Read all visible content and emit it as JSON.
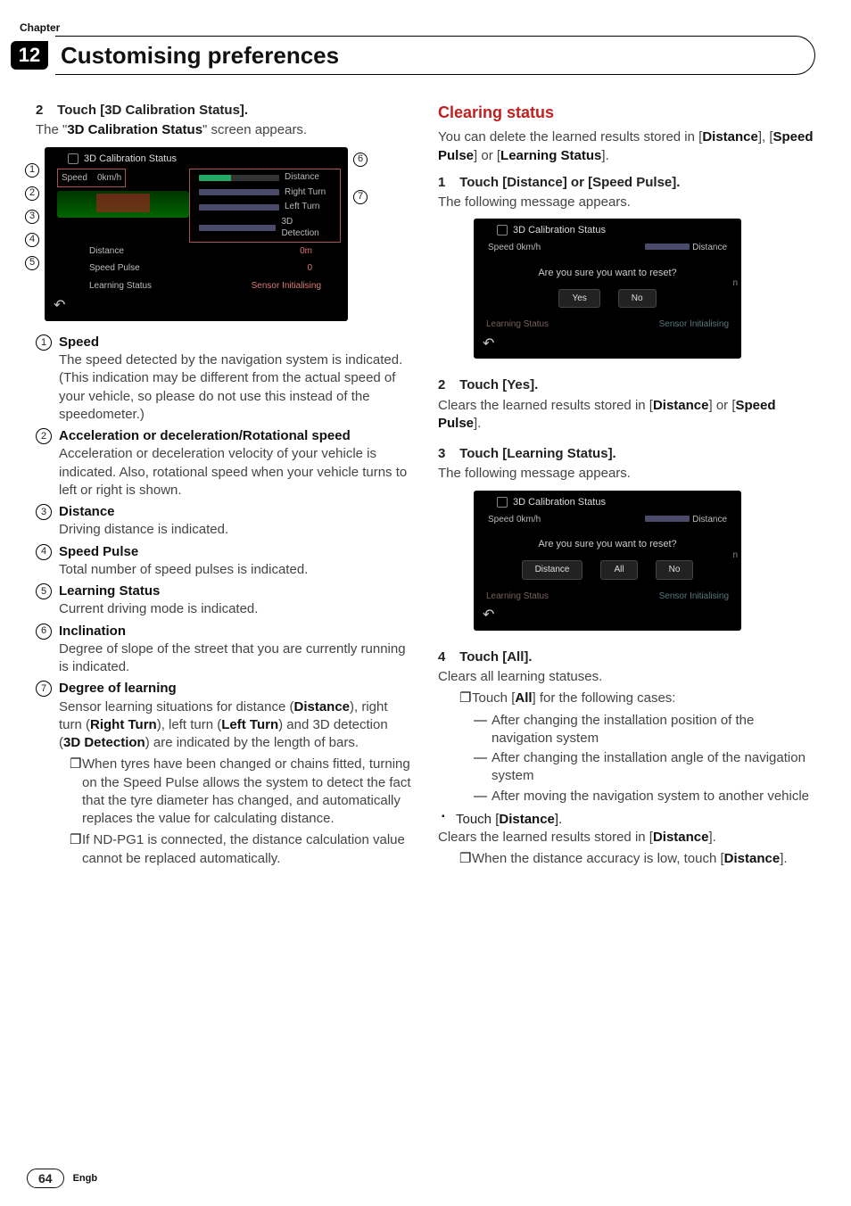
{
  "chapter": {
    "label": "Chapter",
    "number": "12",
    "title": "Customising preferences"
  },
  "left": {
    "step2": {
      "num": "2",
      "title": "Touch [3D Calibration Status].",
      "desc_a": "The \"",
      "desc_b": "3D Calibration Status",
      "desc_c": "\" screen appears."
    },
    "fig1": {
      "title": "3D Calibration Status",
      "speed_lbl": "Speed",
      "speed_val": "0km/h",
      "bars": [
        {
          "label": "Distance"
        },
        {
          "label": "Right Turn"
        },
        {
          "label": "Left Turn"
        },
        {
          "label": "3D Detection"
        }
      ],
      "rows": [
        {
          "label": "Distance",
          "val": "0m"
        },
        {
          "label": "Speed Pulse",
          "val": "0"
        },
        {
          "label": "Learning Status",
          "val": "Sensor Initialising"
        }
      ],
      "callouts_left": [
        "1",
        "2",
        "3",
        "4",
        "5"
      ],
      "callouts_right": [
        "6",
        "7"
      ]
    },
    "defs": [
      {
        "n": "1",
        "title": "Speed",
        "desc": "The speed detected by the navigation system is indicated. (This indication may be different from the actual speed of your vehicle, so please do not use this instead of the speedometer.)"
      },
      {
        "n": "2",
        "title": "Acceleration or deceleration/Rotational speed",
        "desc": "Acceleration or deceleration velocity of your vehicle is indicated. Also, rotational speed when your vehicle turns to left or right is shown."
      },
      {
        "n": "3",
        "title": "Distance",
        "desc": "Driving distance is indicated."
      },
      {
        "n": "4",
        "title": "Speed Pulse",
        "desc": "Total number of speed pulses is indicated."
      },
      {
        "n": "5",
        "title": "Learning Status",
        "desc": "Current driving mode is indicated."
      },
      {
        "n": "6",
        "title": "Inclination",
        "desc": "Degree of slope of the street that you are currently running is indicated."
      },
      {
        "n": "7",
        "title": "Degree of learning",
        "desc_parts": [
          "Sensor learning situations for distance (",
          "Distance",
          "), right turn (",
          "Right Turn",
          "), left turn (",
          "Left Turn",
          ") and 3D detection (",
          "3D Detection",
          ") are indicated by the length of bars."
        ]
      }
    ],
    "sub_bullets": [
      "When tyres have been changed or chains fitted, turning on the Speed Pulse allows the system to detect the fact that the tyre diameter has changed, and automatically replaces the value for calculating distance.",
      "If ND-PG1 is connected, the distance calculation value cannot be replaced automatically."
    ]
  },
  "right": {
    "h1": "Clearing status",
    "intro_parts": [
      "You can delete the learned results stored in [",
      "Distance",
      "], [",
      "Speed Pulse",
      "] or [",
      "Learning Status",
      "]."
    ],
    "step1": {
      "num": "1",
      "title": "Touch [Distance] or [Speed Pulse].",
      "desc": "The following message appears."
    },
    "fig2": {
      "title": "3D Calibration Status",
      "speed_lbl": "Speed",
      "speed_val": "0km/h",
      "dist_lbl": "Distance",
      "msg": "Are you sure you want to reset?",
      "btns": [
        "Yes",
        "No"
      ],
      "foot_l": "Learning Status",
      "foot_r": "Sensor Initialising",
      "edge": "n"
    },
    "step2": {
      "num": "2",
      "title": "Touch [Yes].",
      "desc_parts": [
        "Clears the learned results stored in [",
        "Distance",
        "] or [",
        "Speed Pulse",
        "]."
      ]
    },
    "step3": {
      "num": "3",
      "title": "Touch [Learning Status].",
      "desc": "The following message appears."
    },
    "fig3": {
      "title": "3D Calibration Status",
      "speed_lbl": "Speed",
      "speed_val": "0km/h",
      "dist_lbl": "Distance",
      "msg": "Are you sure you want to reset?",
      "btns": [
        "Distance",
        "All",
        "No"
      ],
      "foot_l": "Learning Status",
      "foot_r": "Sensor Initialising",
      "edge": "n"
    },
    "step4": {
      "num": "4",
      "title": "Touch [All].",
      "desc": "Clears all learning statuses."
    },
    "all_lead_parts": [
      "Touch [",
      "All",
      "] for the following cases:"
    ],
    "dashes": [
      "After changing the installation position of the navigation system",
      "After changing the installation angle of the navigation system",
      "After moving the navigation system to another vehicle"
    ],
    "touch_dist_parts": [
      "Touch [",
      "Distance",
      "]."
    ],
    "clears_dist_parts": [
      "Clears the learned results stored in [",
      "Distance",
      "]."
    ],
    "when_low_parts": [
      "When the distance accuracy is low, touch [",
      "Distance",
      "]."
    ]
  },
  "footer": {
    "page": "64",
    "lang": "Engb"
  },
  "glyph": {
    "note": "❐",
    "square": "▪",
    "dash": "—",
    "back": "↶"
  }
}
